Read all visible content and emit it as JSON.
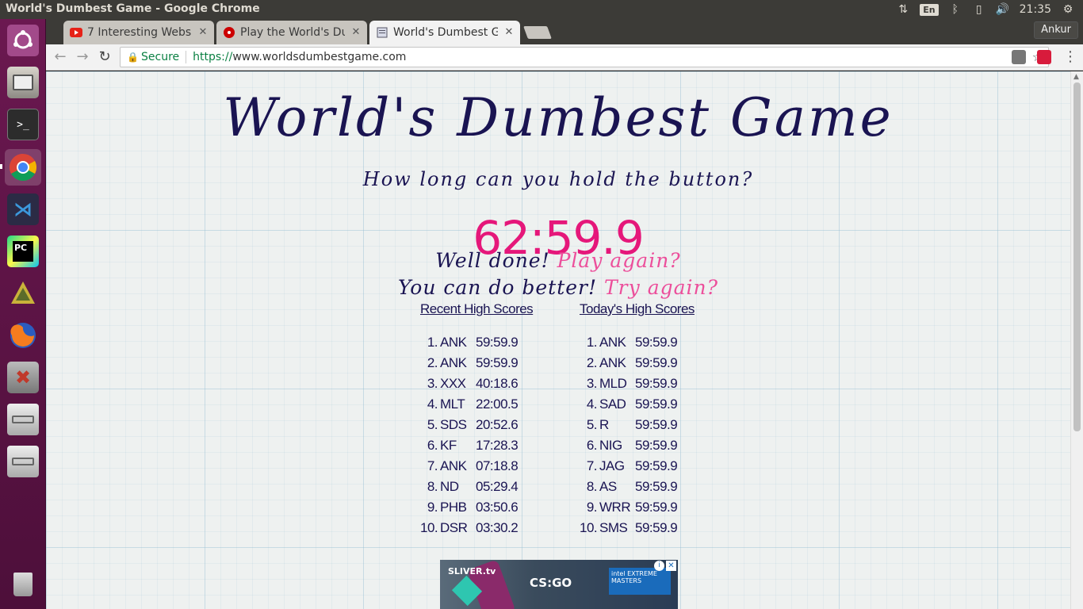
{
  "window_title": "World's Dumbest Game - Google Chrome",
  "tray": {
    "keyboard": "En",
    "clock": "21:35"
  },
  "tabs": [
    {
      "label": "7 Interesting Websi",
      "favicon": "youtube-icon",
      "color": "#e62117"
    },
    {
      "label": "Play the World's Du",
      "favicon": "red-dot-icon",
      "color": "#cc0000"
    },
    {
      "label": "World's Dumbest G",
      "favicon": "page-icon",
      "active": true
    }
  ],
  "profile_button": "Ankur",
  "omnibox": {
    "secure_label": "Secure",
    "scheme": "https://",
    "host": "www.worldsdumbestgame.com"
  },
  "page": {
    "title": "World's Dumbest Game",
    "subtitle": "How long can you hold the button?",
    "timer": "62:59.9",
    "line1_prefix": "Well done!",
    "line1_link": "Play again?",
    "line2_prefix": "You can do better!",
    "line2_link": "Try again?",
    "accent_color": "#e5177a",
    "ink_color": "#1a1452"
  },
  "recent_scores": {
    "heading": "Recent High Scores",
    "rows": [
      {
        "rank": "1.",
        "name": "ANK",
        "time": "59:59.9"
      },
      {
        "rank": "2.",
        "name": "ANK",
        "time": "59:59.9"
      },
      {
        "rank": "3.",
        "name": "XXX",
        "time": "40:18.6"
      },
      {
        "rank": "4.",
        "name": "MLT",
        "time": "22:00.5"
      },
      {
        "rank": "5.",
        "name": "SDS",
        "time": "20:52.6"
      },
      {
        "rank": "6.",
        "name": "KF",
        "time": "17:28.3"
      },
      {
        "rank": "7.",
        "name": "ANK",
        "time": "07:18.8"
      },
      {
        "rank": "8.",
        "name": "ND",
        "time": "05:29.4"
      },
      {
        "rank": "9.",
        "name": "PHB",
        "time": "03:50.6"
      },
      {
        "rank": "10.",
        "name": "DSR",
        "time": "03:30.2"
      }
    ]
  },
  "today_scores": {
    "heading": "Today's High Scores",
    "rows": [
      {
        "rank": "1.",
        "name": "ANK",
        "time": "59:59.9"
      },
      {
        "rank": "2.",
        "name": "ANK",
        "time": "59:59.9"
      },
      {
        "rank": "3.",
        "name": "MLD",
        "time": "59:59.9"
      },
      {
        "rank": "4.",
        "name": "SAD",
        "time": "59:59.9"
      },
      {
        "rank": "5.",
        "name": "R",
        "time": "59:59.9"
      },
      {
        "rank": "6.",
        "name": "NIG",
        "time": "59:59.9"
      },
      {
        "rank": "7.",
        "name": "JAG",
        "time": "59:59.9"
      },
      {
        "rank": "8.",
        "name": "AS",
        "time": "59:59.9"
      },
      {
        "rank": "9.",
        "name": "WRR",
        "time": "59:59.9"
      },
      {
        "rank": "10.",
        "name": "SMS",
        "time": "59:59.9"
      }
    ]
  },
  "ad": {
    "brand1": "SLIVER.tv",
    "brand2": "CS:GO",
    "brand3": "intel EXTREME MASTERS"
  },
  "launcher": [
    "ubuntu-dash-icon",
    "files-icon",
    "terminal-icon",
    "chrome-icon",
    "vscode-icon",
    "pycharm-icon",
    "app-icon",
    "firefox-icon",
    "settings-icon",
    "drive-icon",
    "drive-icon",
    "trash-icon"
  ]
}
